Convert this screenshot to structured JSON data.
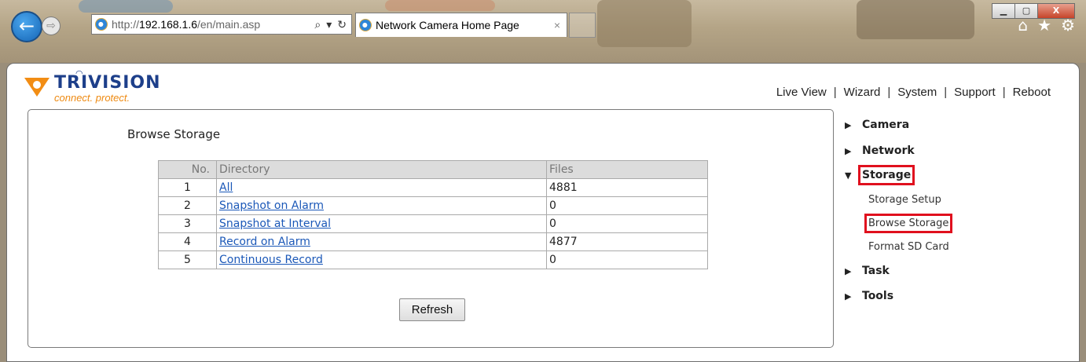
{
  "browser": {
    "url_prefix": "http://",
    "url_host": "192.168.1.6",
    "url_path": "/en/main.asp",
    "tab_title": "Network Camera Home Page",
    "tab_close": "×",
    "min_glyph": "▁",
    "max_glyph": "▢",
    "close_glyph": "X"
  },
  "logo": {
    "name": "TRIVISION",
    "tagline": "connect. protect."
  },
  "topnav": [
    "Live View",
    "Wizard",
    "System",
    "Support",
    "Reboot"
  ],
  "page": {
    "title": "Browse Storage",
    "columns": [
      "No.",
      "Directory",
      "Files"
    ],
    "rows": [
      {
        "no": "1",
        "directory": "All",
        "files": "4881"
      },
      {
        "no": "2",
        "directory": "Snapshot on Alarm",
        "files": "0"
      },
      {
        "no": "3",
        "directory": "Snapshot at Interval",
        "files": "0"
      },
      {
        "no": "4",
        "directory": "Record on Alarm",
        "files": "4877"
      },
      {
        "no": "5",
        "directory": "Continuous Record",
        "files": "0"
      }
    ],
    "refresh_label": "Refresh"
  },
  "menu": {
    "camera": "Camera",
    "network": "Network",
    "storage": "Storage",
    "storage_setup": "Storage Setup",
    "browse_storage": "Browse Storage",
    "format_sd": "Format SD Card",
    "task": "Task",
    "tools": "Tools"
  },
  "colors": {
    "highlight": "#e0101e",
    "link": "#1b58b8",
    "logo_blue": "#1d3f8a",
    "logo_orange": "#f28d14"
  }
}
